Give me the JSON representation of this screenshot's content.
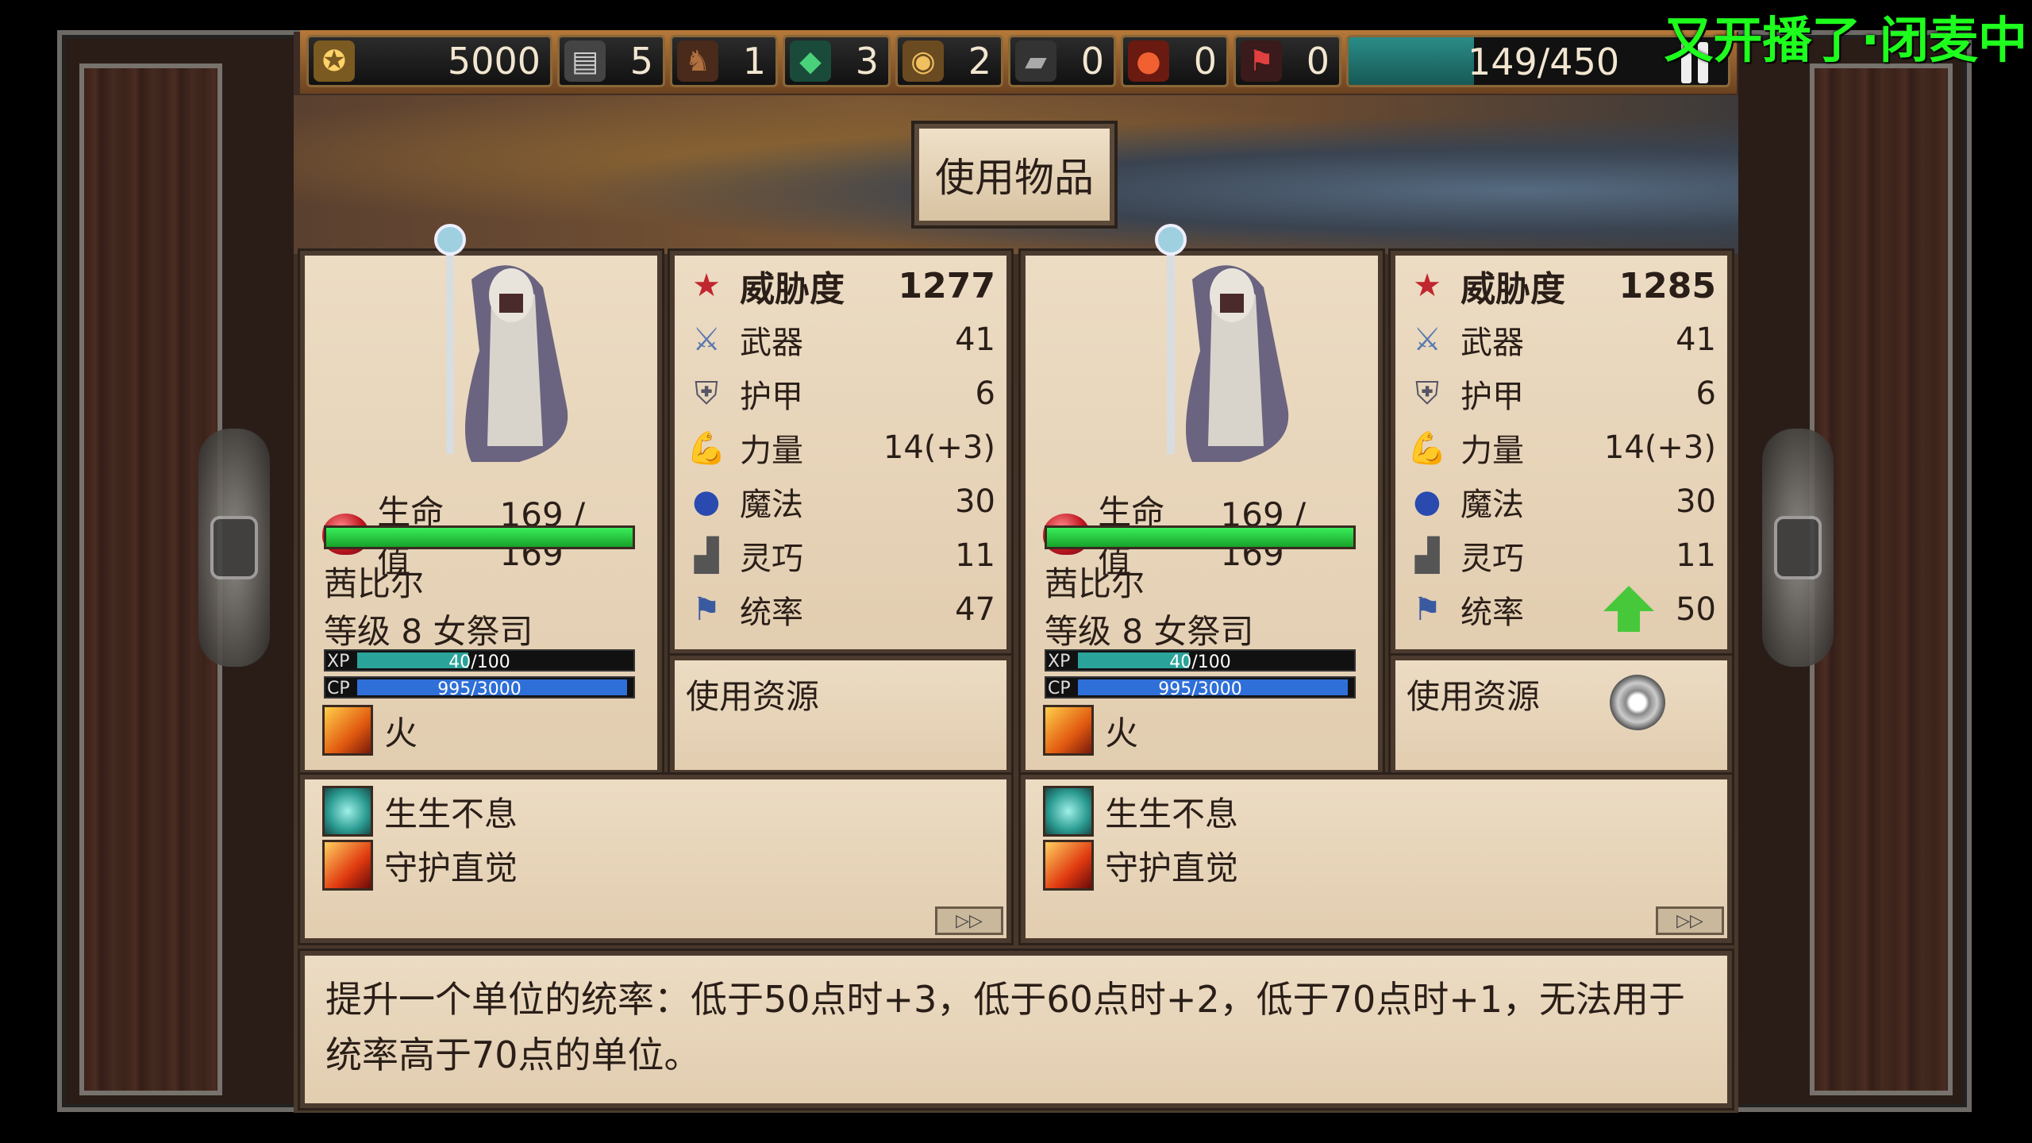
{
  "watermark": "又开播了·闭麦中",
  "topbar": {
    "resources": [
      {
        "icon": "gold-icon",
        "value": "5000"
      },
      {
        "icon": "scroll-icon",
        "value": "5"
      },
      {
        "icon": "horse-icon",
        "value": "1"
      },
      {
        "icon": "gem-icon",
        "value": "3"
      },
      {
        "icon": "coin-icon",
        "value": "2"
      },
      {
        "icon": "iron-icon",
        "value": "0"
      },
      {
        "icon": "ore-icon",
        "value": "0"
      },
      {
        "icon": "banner-icon",
        "value": "0"
      }
    ],
    "army": "149/450"
  },
  "use_item_button": "使用物品",
  "before": {
    "hp_label": "生命值",
    "hp": "169 / 169",
    "name": "茜比尔",
    "class_line": "等级 8 女祭司",
    "xp_label": "XP",
    "xp": "40/100",
    "cp_label": "CP",
    "cp": "995/3000",
    "element": "火",
    "stats": [
      {
        "label": "威胁度",
        "value": "1277"
      },
      {
        "label": "武器",
        "value": "41"
      },
      {
        "label": "护甲",
        "value": "6"
      },
      {
        "label": "力量",
        "value": "14(+3)"
      },
      {
        "label": "魔法",
        "value": "30"
      },
      {
        "label": "灵巧",
        "value": "11"
      },
      {
        "label": "统率",
        "value": "47"
      }
    ],
    "resource_title": "使用资源",
    "skills": [
      "生生不息",
      "守护直觉"
    ]
  },
  "after": {
    "hp_label": "生命值",
    "hp": "169 / 169",
    "name": "茜比尔",
    "class_line": "等级 8 女祭司",
    "xp_label": "XP",
    "xp": "40/100",
    "cp_label": "CP",
    "cp": "995/3000",
    "element": "火",
    "stats": [
      {
        "label": "威胁度",
        "value": "1285"
      },
      {
        "label": "武器",
        "value": "41"
      },
      {
        "label": "护甲",
        "value": "6"
      },
      {
        "label": "力量",
        "value": "14(+3)"
      },
      {
        "label": "魔法",
        "value": "30"
      },
      {
        "label": "灵巧",
        "value": "11"
      },
      {
        "label": "统率",
        "value": "50"
      }
    ],
    "resource_title": "使用资源",
    "skills": [
      "生生不息",
      "守护直觉"
    ]
  },
  "description_line1": "提升一个单位的统率：低于50点时+3，低于60点时+2，低于70点时+1，无法用于",
  "description_line2": "统率高于70点的单位。",
  "colors": {
    "hp_green": "#2fd24a",
    "xp_teal": "#2aa39a",
    "cp_blue": "#2f6fd8",
    "watermark": "#1eff1e",
    "levelup_arrow": "#46c83a"
  }
}
